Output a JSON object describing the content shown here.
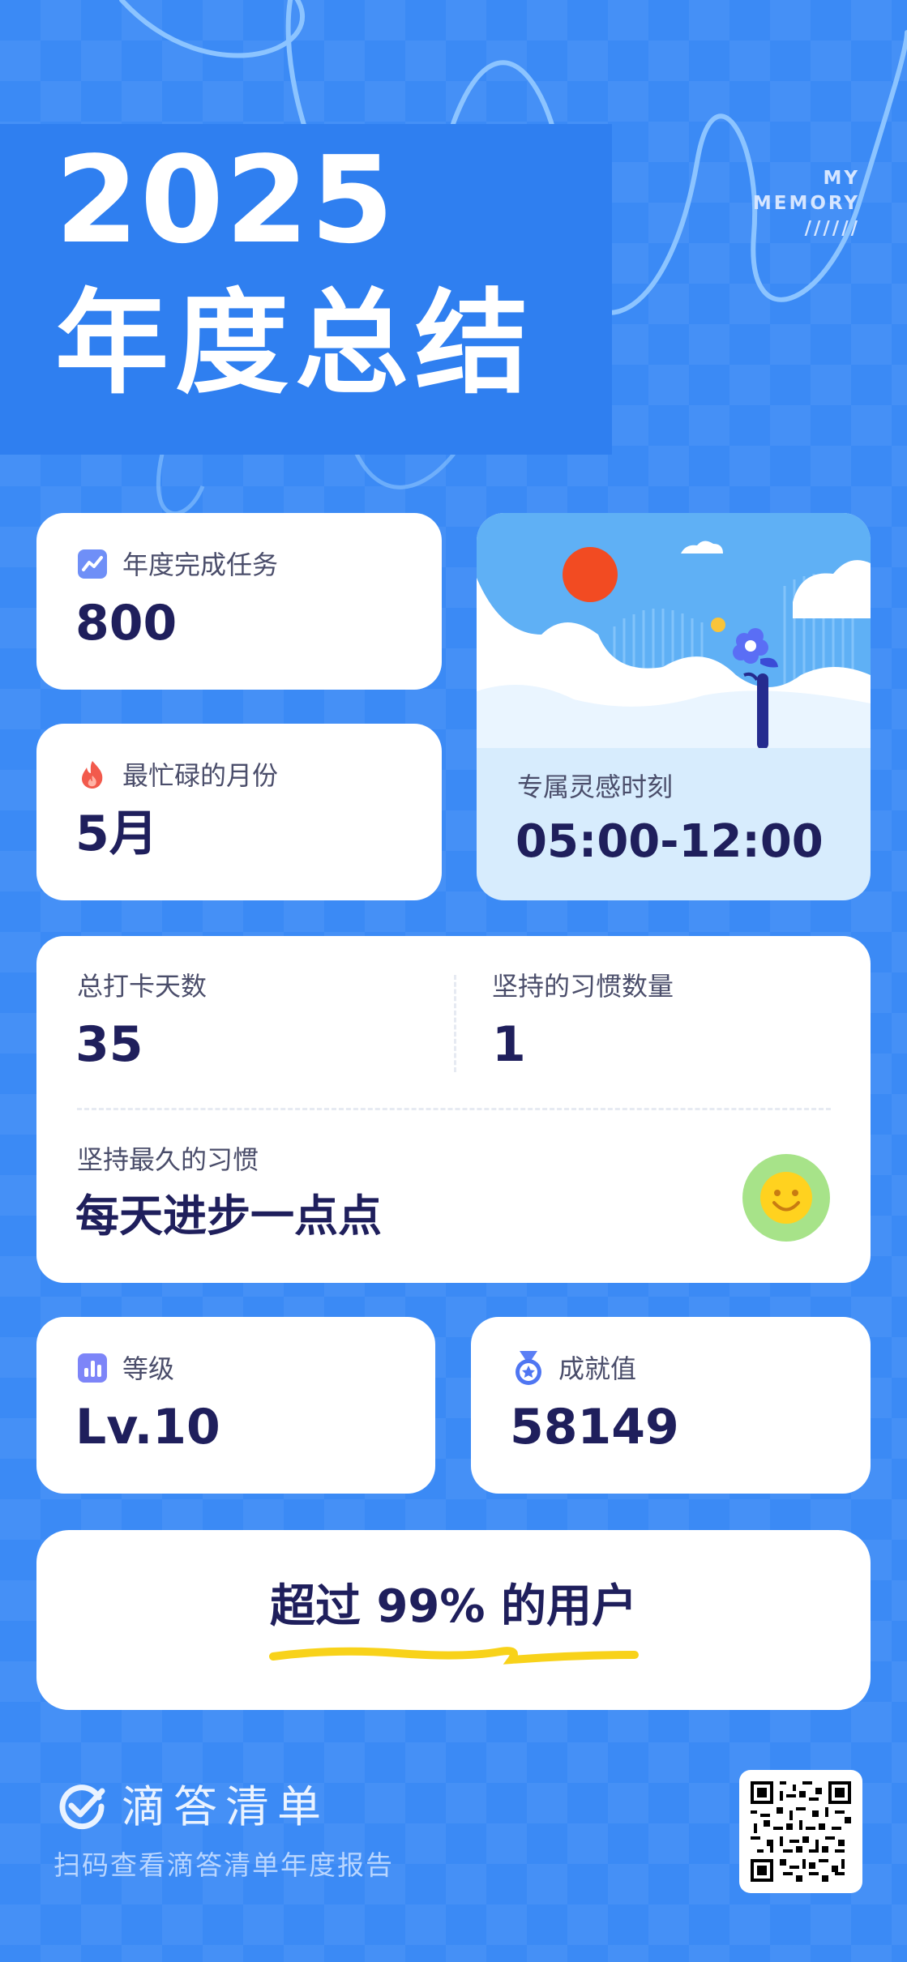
{
  "colors": {
    "background": "#3b8af5",
    "card": "#ffffff",
    "value_text": "#1f1f5c",
    "label_text": "#4a4d6a",
    "highlight_underline": "#f8d21a"
  },
  "header": {
    "year": "2025",
    "subtitle": "年度总结",
    "my_memory_line1": "MY",
    "my_memory_line2": "MEMORY",
    "my_memory_line3": "//////"
  },
  "stats": {
    "tasks_completed": {
      "label": "年度完成任务",
      "value": "800",
      "icon": "trend-chart-icon"
    },
    "busiest_month": {
      "label": "最忙碌的月份",
      "value": "5月",
      "icon": "flame-icon"
    },
    "inspiration_time": {
      "label": "专属灵感时刻",
      "value": "05:00-12:00"
    },
    "checkin_days": {
      "label": "总打卡天数",
      "value": "35"
    },
    "habits_count": {
      "label": "坚持的习惯数量",
      "value": "1"
    },
    "longest_habit": {
      "label": "坚持最久的习惯",
      "value": "每天进步一点点",
      "icon": "smiley-icon"
    },
    "level": {
      "label": "等级",
      "value": "Lv.10",
      "icon": "bar-chart-icon"
    },
    "achievement": {
      "label": "成就值",
      "value": "58149",
      "icon": "medal-icon"
    }
  },
  "ranking": {
    "prefix": "超过",
    "percent": "99%",
    "suffix": "的用户"
  },
  "footer": {
    "brand_name": "滴答清单",
    "brand_icon": "checkmark-icon",
    "scan_text": "扫码查看滴答清单年度报告",
    "qr_icon": "qr-code-icon"
  }
}
